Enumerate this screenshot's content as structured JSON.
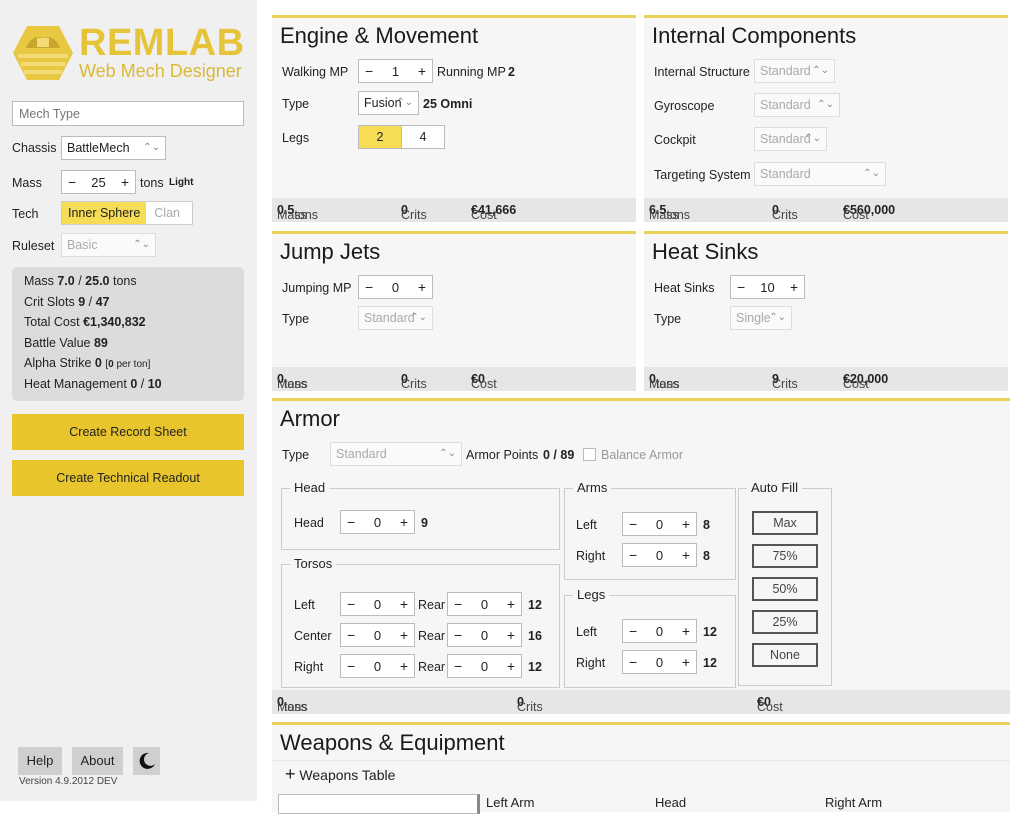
{
  "sidebar": {
    "logo": {
      "brand": "REMLAB",
      "subtitle": "Web Mech Designer",
      "brand_color": "#e6c43a"
    },
    "mech_type": {
      "value": "",
      "placeholder": "Mech Type"
    },
    "chassis": {
      "label": "Chassis",
      "value": "BattleMech"
    },
    "mass": {
      "label": "Mass",
      "value": "25",
      "unit": "tons",
      "class": "Light"
    },
    "tech": {
      "label": "Tech",
      "options": [
        "Inner Sphere",
        "Clan"
      ],
      "selected": "Inner Sphere"
    },
    "ruleset": {
      "label": "Ruleset",
      "value": "Basic"
    },
    "stats": {
      "mass_label": "Mass",
      "mass_value": "7.0",
      "mass_max": "25.0",
      "mass_unit": "tons",
      "crit_label": "Crit Slots",
      "crit_value": "9",
      "crit_max": "47",
      "cost_label": "Total Cost",
      "cost_value": "€1,340,832",
      "bv_label": "Battle Value",
      "bv_value": "89",
      "alpha_label": "Alpha Strike",
      "alpha_value": "0",
      "alpha_per_ton": "0",
      "alpha_per_ton_unit": "per ton",
      "heat_label": "Heat Management",
      "heat_value": "0",
      "heat_max": "10"
    },
    "buttons": {
      "record_sheet": "Create Record Sheet",
      "tech_readout": "Create Technical Readout",
      "help": "Help",
      "about": "About"
    },
    "version": "Version 4.9.2012 DEV"
  },
  "engine": {
    "title": "Engine & Movement",
    "walking_label": "Walking MP",
    "walking_value": "1",
    "running_label": "Running MP",
    "running_value": "2",
    "type_label": "Type",
    "type_value": "Fusion",
    "engine_rating": "25 Omni",
    "legs_label": "Legs",
    "legs_options": [
      "2",
      "4"
    ],
    "legs_selected": "2",
    "footer": {
      "mass_label": "Mass",
      "mass": "0.5",
      "unit": "tons",
      "crits_label": "Crits",
      "crits": "0",
      "cost_label": "Cost",
      "cost": "€41,666"
    }
  },
  "internal": {
    "title": "Internal Components",
    "rows": [
      {
        "label": "Internal Structure",
        "value": "Standard"
      },
      {
        "label": "Gyroscope",
        "value": "Standard"
      },
      {
        "label": "Cockpit",
        "value": "Standard"
      },
      {
        "label": "Targeting System",
        "value": "Standard"
      }
    ],
    "footer": {
      "mass_label": "Mass",
      "mass": "6.5",
      "unit": "tons",
      "crits_label": "Crits",
      "crits": "0",
      "cost_label": "Cost",
      "cost": "€560,000"
    }
  },
  "jumpjets": {
    "title": "Jump Jets",
    "jumping_label": "Jumping MP",
    "jumping_value": "0",
    "type_label": "Type",
    "type_value": "Standard",
    "footer": {
      "mass_label": "Mass",
      "mass": "0",
      "unit": "tons",
      "crits_label": "Crits",
      "crits": "0",
      "cost_label": "Cost",
      "cost": "€0"
    }
  },
  "heatsinks": {
    "title": "Heat Sinks",
    "count_label": "Heat Sinks",
    "count_value": "10",
    "type_label": "Type",
    "type_value": "Single",
    "footer": {
      "mass_label": "Mass",
      "mass": "0",
      "unit": "tons",
      "crits_label": "Crits",
      "crits": "9",
      "cost_label": "Cost",
      "cost": "€20,000"
    }
  },
  "armor": {
    "title": "Armor",
    "type_label": "Type",
    "type_value": "Standard",
    "points_label": "Armor Points",
    "points_value": "0",
    "points_max": "89",
    "balance_label": "Balance Armor",
    "head": {
      "legend": "Head",
      "label": "Head",
      "value": "0",
      "max": "9"
    },
    "torsos": {
      "legend": "Torsos",
      "rear_label": "Rear",
      "rows": [
        {
          "label": "Left",
          "front": "0",
          "rear": "0",
          "max": "12"
        },
        {
          "label": "Center",
          "front": "0",
          "rear": "0",
          "max": "16"
        },
        {
          "label": "Right",
          "front": "0",
          "rear": "0",
          "max": "12"
        }
      ]
    },
    "arms": {
      "legend": "Arms",
      "rows": [
        {
          "label": "Left",
          "value": "0",
          "max": "8"
        },
        {
          "label": "Right",
          "value": "0",
          "max": "8"
        }
      ]
    },
    "legs": {
      "legend": "Legs",
      "rows": [
        {
          "label": "Left",
          "value": "0",
          "max": "12"
        },
        {
          "label": "Right",
          "value": "0",
          "max": "12"
        }
      ]
    },
    "autofill": {
      "legend": "Auto Fill",
      "buttons": [
        "Max",
        "75%",
        "50%",
        "25%",
        "None"
      ]
    },
    "footer": {
      "mass_label": "Mass",
      "mass": "0",
      "unit": "tons",
      "crits_label": "Crits",
      "crits": "0",
      "cost_label": "Cost",
      "cost": "€0"
    }
  },
  "weapons": {
    "title": "Weapons & Equipment",
    "table_toggle": "Weapons Table",
    "columns": [
      "Left Arm",
      "Head",
      "Right Arm"
    ]
  },
  "colors": {
    "accent": "#e9c52d",
    "selected": "#f7dd55",
    "panel_border": "#ebd15a"
  }
}
